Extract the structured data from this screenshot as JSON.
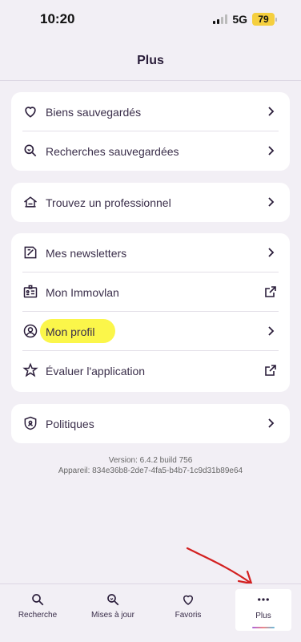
{
  "status": {
    "time": "10:20",
    "network": "5G",
    "battery": "79"
  },
  "header": {
    "title": "Plus"
  },
  "groups": [
    {
      "items": [
        {
          "label": "Biens sauvegardés",
          "icon": "heart-icon",
          "trail": "chevron-right-icon"
        },
        {
          "label": "Recherches sauvegardées",
          "icon": "saved-search-icon",
          "trail": "chevron-right-icon"
        }
      ]
    },
    {
      "items": [
        {
          "label": "Trouvez un professionnel",
          "icon": "professional-house-icon",
          "trail": "chevron-right-icon"
        }
      ]
    },
    {
      "items": [
        {
          "label": "Mes newsletters",
          "icon": "newsletter-icon",
          "trail": "chevron-right-icon"
        },
        {
          "label": "Mon Immovlan",
          "icon": "id-badge-icon",
          "trail": "external-link-icon"
        },
        {
          "label": "Mon profil",
          "icon": "user-circle-icon",
          "trail": "chevron-right-icon",
          "highlighted": true
        },
        {
          "label": "Évaluer l'application",
          "icon": "star-rating-icon",
          "trail": "external-link-icon"
        }
      ]
    },
    {
      "items": [
        {
          "label": "Politiques",
          "icon": "shield-icon",
          "trail": "chevron-right-icon"
        }
      ]
    }
  ],
  "version": {
    "line1": "Version: 6.4.2 build 756",
    "line2": "Appareil: 834e36b8-2de7-4fa5-b4b7-1c9d31b89e64"
  },
  "tabbar": [
    {
      "label": "Recherche",
      "icon": "search-icon"
    },
    {
      "label": "Mises à jour",
      "icon": "update-search-icon"
    },
    {
      "label": "Favoris",
      "icon": "heart-icon"
    },
    {
      "label": "Plus",
      "icon": "more-dots-icon",
      "active": true
    }
  ],
  "colors": {
    "background": "#f2eff5",
    "text": "#2a1d3a",
    "highlight": "#fbf64a",
    "annotation": "#d32020"
  }
}
